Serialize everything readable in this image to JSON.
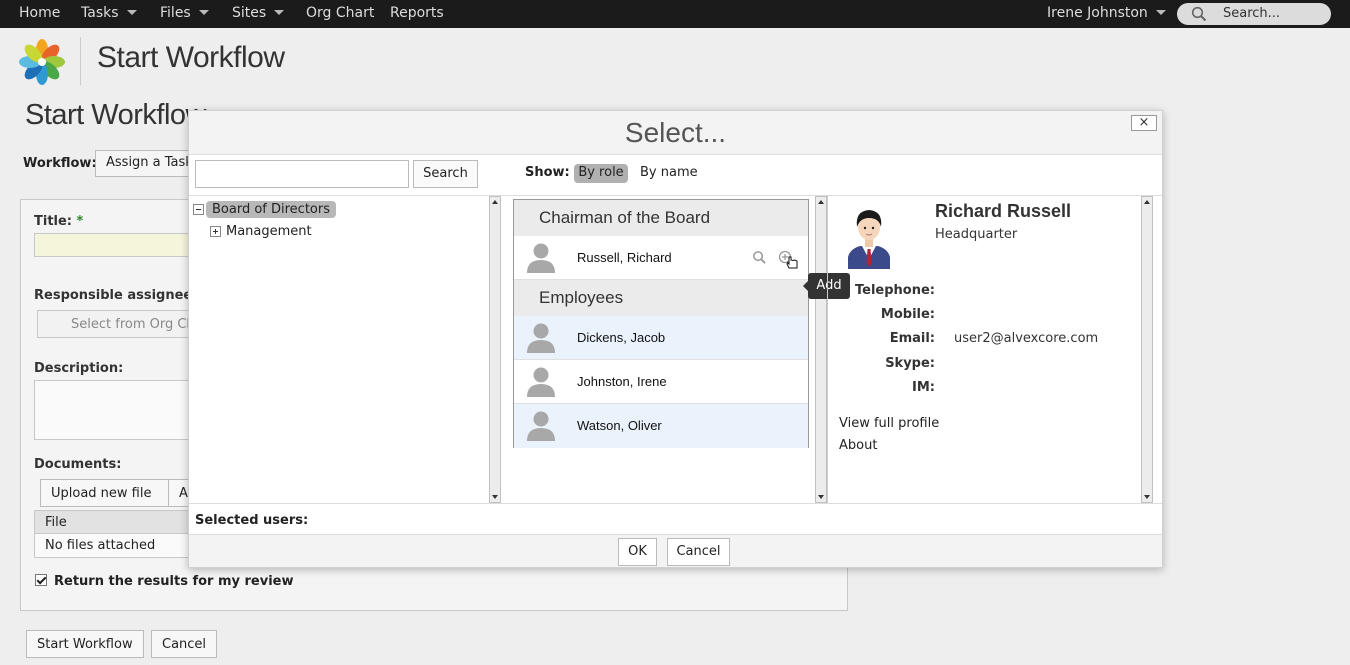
{
  "topnav": {
    "items": [
      {
        "label": "Home",
        "has_menu": false
      },
      {
        "label": "Tasks",
        "has_menu": true
      },
      {
        "label": "Files",
        "has_menu": true
      },
      {
        "label": "Sites",
        "has_menu": true
      },
      {
        "label": "Org Chart",
        "has_menu": false
      },
      {
        "label": "Reports",
        "has_menu": false
      }
    ],
    "user": "Irene Johnston",
    "search_placeholder": "Search..."
  },
  "header": {
    "app_title": "Start Workflow"
  },
  "page": {
    "title": "Start Workflow",
    "workflow_label": "Workflow:",
    "workflow_value": "Assign a Task",
    "form": {
      "title_label": "Title:",
      "required_mark": "*",
      "assignee_label": "Responsible assignee:",
      "assignee_button": "Select from Org Chart",
      "description_label": "Description:",
      "documents_label": "Documents:",
      "upload_button": "Upload new file",
      "attach_button": "Attach",
      "files_column": "File",
      "files_empty": "No files attached",
      "review_label": "Return the results for my review",
      "review_checked": true
    },
    "start_button": "Start Workflow",
    "cancel_button": "Cancel"
  },
  "dialog": {
    "title": "Select...",
    "close_label": "×",
    "search_value": "",
    "search_button": "Search",
    "show_label": "Show:",
    "show_options": [
      "By role",
      "By name"
    ],
    "show_selected": "By role",
    "tree": [
      {
        "label": "Board of Directors",
        "expanded": true,
        "selected": true
      },
      {
        "label": "Management",
        "expanded": false,
        "selected": false
      }
    ],
    "groups": [
      {
        "title": "Chairman of the Board",
        "members": [
          "Russell, Richard"
        ]
      },
      {
        "title": "Employees",
        "members": [
          "Dickens, Jacob",
          "Johnston, Irene",
          "Watson, Oliver"
        ]
      }
    ],
    "tooltip": "Add",
    "profile": {
      "name": "Richard Russell",
      "org": "Headquarter",
      "fields": [
        {
          "label": "Telephone:",
          "value": ""
        },
        {
          "label": "Mobile:",
          "value": ""
        },
        {
          "label": "Email:",
          "value": "user2@alvexcore.com"
        },
        {
          "label": "Skype:",
          "value": ""
        },
        {
          "label": "IM:",
          "value": ""
        }
      ],
      "view_full_profile": "View full profile",
      "about": "About"
    },
    "selected_users_label": "Selected users:",
    "ok_button": "OK",
    "cancel_button": "Cancel"
  },
  "colors": {
    "topbar": "#1b1b1b",
    "selected_chip": "#b0b0b0",
    "alt_row": "#eaf2fb",
    "required": "#2a8a2a"
  }
}
